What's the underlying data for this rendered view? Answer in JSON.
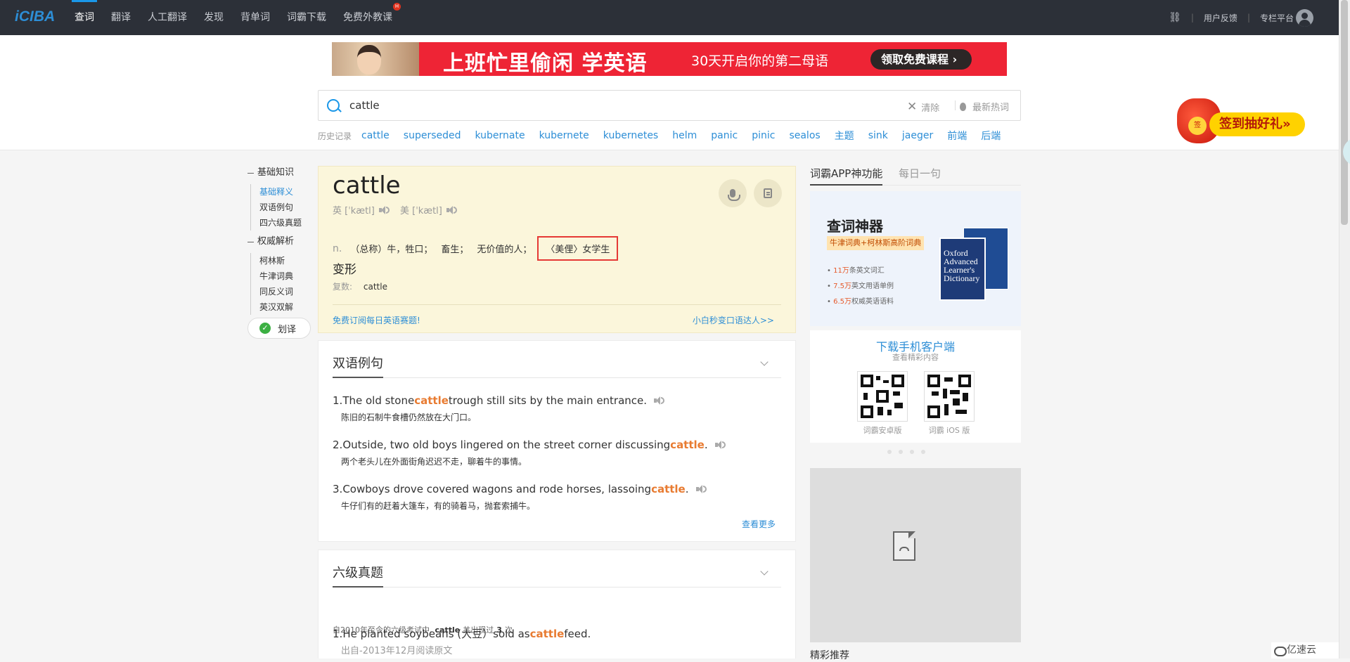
{
  "topbar": {
    "logo": "iCIBA",
    "nav": [
      "查词",
      "翻译",
      "人工翻译",
      "发现",
      "背单词",
      "词霸下载",
      "免费外教课"
    ],
    "nav_badge": "H",
    "right": [
      "用户反馈",
      "专栏平台"
    ]
  },
  "banner": {
    "main": "上班忙里偷闲 学英语",
    "sub": "30天开启你的第二母语",
    "cta": "领取免费课程"
  },
  "search": {
    "value": "cattle",
    "clear": "清除",
    "hot": "最新热词"
  },
  "history": {
    "label": "历史记录",
    "items": [
      "cattle",
      "superseded",
      "kubernate",
      "kubernete",
      "kubernetes",
      "helm",
      "panic",
      "pinic",
      "sealos",
      "主题",
      "sink",
      "jaeger",
      "前端",
      "后端"
    ]
  },
  "lucky": {
    "coin": "签",
    "label": "签到抽好礼»"
  },
  "side_nav": {
    "group1": "基础知识",
    "group1_items": [
      "基础释义",
      "双语例句",
      "四六级真题"
    ],
    "group2": "权威解析",
    "group2_items": [
      "柯林斯",
      "牛津词典",
      "同反义词",
      "英汉双解"
    ],
    "huayi": "划译"
  },
  "definition": {
    "word": "cattle",
    "uk": "英 [ˈkætl]",
    "us": "美 [ˈkætl]",
    "pos": "n.",
    "meanings": [
      "（总称）牛，牲口；",
      "畜生；",
      "无价值的人；",
      "〈美俚〉女学生"
    ],
    "bx_title": "变形",
    "bx_label": "复数:",
    "bx_value": "cattle",
    "link_left": "免费订阅每日英语赛题!",
    "link_right": "小白秒变口语达人>>"
  },
  "examples": {
    "title": "双语例句",
    "items": [
      {
        "num": "1.",
        "pre": "The old stone ",
        "hl": "cattle",
        "post": " trough still sits by the main entrance.",
        "cn": "陈旧的石制牛食槽仍然放在大门口。"
      },
      {
        "num": "2.",
        "pre": "Outside, two old boys lingered on the street corner discussing ",
        "hl": "cattle",
        "post": ".",
        "cn": "两个老头儿在外面街角迟迟不走，聊着牛的事情。"
      },
      {
        "num": "3.",
        "pre": "Cowboys drove covered wagons and rode horses, lassoing ",
        "hl": "cattle",
        "post": ".",
        "cn": "牛仔们有的赶着大篷车，有的骑着马，抛套索捕牛。"
      }
    ],
    "more": "查看更多"
  },
  "cet6": {
    "title": "六级真题",
    "meta_pre": "自2010年至今的六级考试中,",
    "meta_word": "cattle",
    "meta_mid": "共出现过",
    "meta_count": "3",
    "meta_post": "次",
    "item": {
      "num": "1.",
      "pre": "He planted soybeans (大豆）sold as ",
      "hl": "cattle",
      "post": " feed."
    },
    "source": "出自-2013年12月阅读原文"
  },
  "right_panel": {
    "tab1": "词霸APP神功能",
    "tab2": "每日一句",
    "promo_title": "查词神器",
    "promo_sub": "牛津词典+柯林斯高阶词典",
    "bullets": [
      {
        "num": "11万",
        "text": "条英文词汇"
      },
      {
        "num": "7.5万",
        "text": "英文用语单例"
      },
      {
        "num": "6.5万",
        "text": "权威英语语料"
      }
    ],
    "book_text": "Oxford Advanced Learner's Dictionary",
    "dl_title": "下载手机客户端",
    "dl_sub": "查看精彩内容",
    "android": "词霸安卓版",
    "ios": "词霸 iOS 版",
    "featured": "精彩推荐"
  },
  "watermark": "亿速云"
}
